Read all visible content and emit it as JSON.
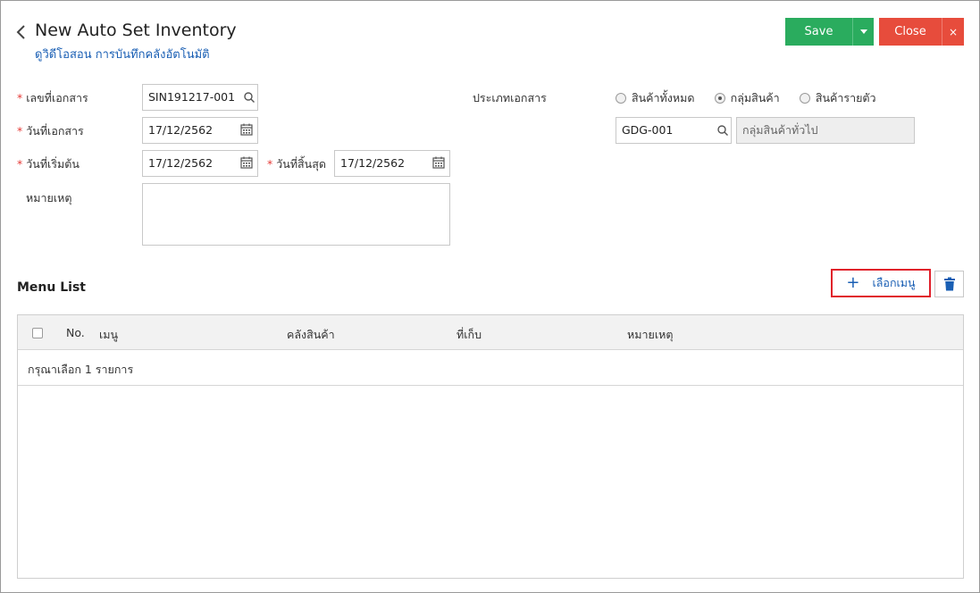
{
  "header": {
    "title": "New Auto Set Inventory",
    "subtitle": "ดูวิดีโอสอน การบันทึกคลังอัตโนมัติ",
    "save_label": "Save",
    "close_label": "Close",
    "close_x": "×"
  },
  "form": {
    "doc_no": {
      "label": "เลขที่เอกสาร",
      "value": "SIN191217-001"
    },
    "doc_date": {
      "label": "วันที่เอกสาร",
      "value": "17/12/2562"
    },
    "start_date": {
      "label": "วันที่เริ่มต้น",
      "value": "17/12/2562"
    },
    "end_date": {
      "label": "วันที่สิ้นสุด",
      "value": "17/12/2562"
    },
    "remark": {
      "label": "หมายเหตุ",
      "value": ""
    },
    "doc_type": {
      "label": "ประเภทเอกสาร",
      "options": [
        "สินค้าทั้งหมด",
        "กลุ่มสินค้า",
        "สินค้ารายตัว"
      ],
      "selected": "กลุ่มสินค้า"
    },
    "group_code": {
      "value": "GDG-001"
    },
    "group_name": {
      "value": "กลุ่มสินค้าทั่วไป"
    },
    "required_mark": "*"
  },
  "menu_list": {
    "title": "Menu List",
    "select_menu_label": "เลือกเมนู",
    "plus": "+",
    "columns": [
      "No.",
      "เมนู",
      "คลังสินค้า",
      "ที่เก็บ",
      "หมายเหตุ"
    ],
    "empty_message": "กรุณาเลือก 1 รายการ"
  },
  "colors": {
    "save": "#2aac5e",
    "close": "#e74c3c",
    "link": "#1a5fb4",
    "highlight": "#e0202a"
  }
}
